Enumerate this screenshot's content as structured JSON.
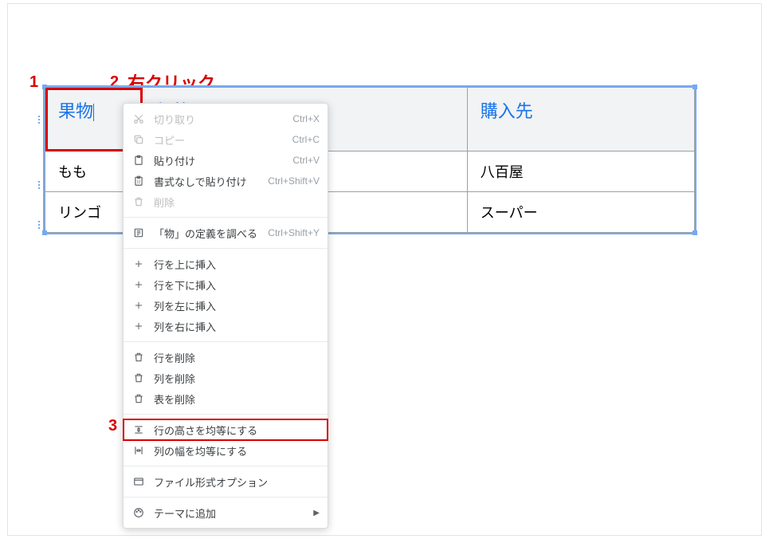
{
  "annotations": {
    "one": "1",
    "two": "2",
    "three": "3",
    "rightclick": "右クリック"
  },
  "table": {
    "headers": [
      "果物",
      "価格(円)",
      "購入先"
    ],
    "rows": [
      [
        "もも",
        "",
        "八百屋"
      ],
      [
        "リンゴ",
        "",
        "スーパー"
      ]
    ]
  },
  "menu": {
    "cut": {
      "label": "切り取り",
      "shortcut": "Ctrl+X"
    },
    "copy": {
      "label": "コピー",
      "shortcut": "Ctrl+C"
    },
    "paste": {
      "label": "貼り付け",
      "shortcut": "Ctrl+V"
    },
    "paste_noformat": {
      "label": "書式なしで貼り付け",
      "shortcut": "Ctrl+Shift+V"
    },
    "delete": {
      "label": "削除"
    },
    "define": {
      "label": "「物」の定義を調べる",
      "shortcut": "Ctrl+Shift+Y"
    },
    "ins_row_above": {
      "label": "行を上に挿入"
    },
    "ins_row_below": {
      "label": "行を下に挿入"
    },
    "ins_col_left": {
      "label": "列を左に挿入"
    },
    "ins_col_right": {
      "label": "列を右に挿入"
    },
    "del_row": {
      "label": "行を削除"
    },
    "del_col": {
      "label": "列を削除"
    },
    "del_table": {
      "label": "表を削除"
    },
    "dist_rows": {
      "label": "行の高さを均等にする"
    },
    "dist_cols": {
      "label": "列の幅を均等にする"
    },
    "file_opts": {
      "label": "ファイル形式オプション"
    },
    "theme": {
      "label": "テーマに追加"
    }
  }
}
